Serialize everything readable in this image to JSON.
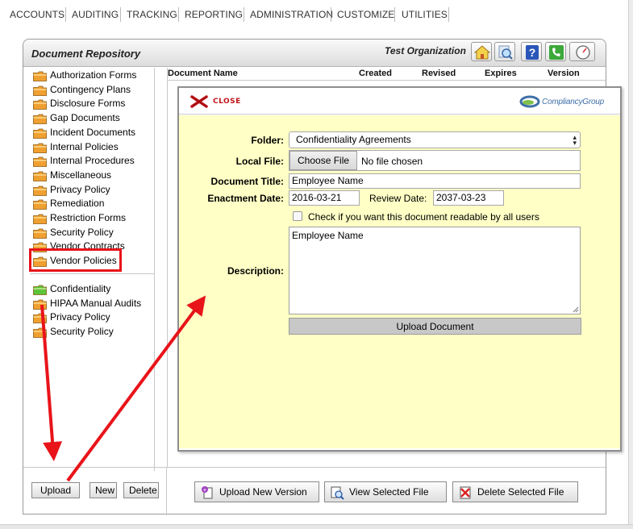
{
  "nav": {
    "items": [
      "ACCOUNTS",
      "AUDITING",
      "TRACKING",
      "REPORTING",
      "ADMINISTRATION",
      "CUSTOMIZE",
      "UTILITIES"
    ]
  },
  "panel": {
    "title": "Document Repository",
    "organization": "Test Organization",
    "header_icons": [
      "home-icon",
      "search-icon",
      "help-icon",
      "phone-icon",
      "gauge-icon"
    ]
  },
  "tree": {
    "folders_top": [
      "Authorization Forms",
      "Contingency Plans",
      "Disclosure Forms",
      "Gap Documents",
      "Incident Documents",
      "Internal Policies",
      "Internal Procedures",
      "Miscellaneous",
      "Privacy Policy",
      "Remediation",
      "Restriction Forms",
      "Security Policy",
      "Vendor Contracts",
      "Vendor Policies"
    ],
    "folders_bottom": [
      "Confidentiality",
      "HIPAA Manual Audits",
      "Privacy Policy",
      "Security Policy"
    ],
    "selected_folder": "Confidentiality"
  },
  "left_buttons": {
    "upload": "Upload",
    "new": "New",
    "delete": "Delete"
  },
  "columns": [
    "Document Name",
    "Created",
    "Revised",
    "Expires",
    "Version"
  ],
  "bottom_buttons": {
    "upload_new_version": "Upload New Version",
    "view_selected_file": "View Selected File",
    "delete_selected_file": "Delete Selected File"
  },
  "modal": {
    "close_label": "CLOSE",
    "logo_text": "CompliancyGroup",
    "folder_label": "Folder:",
    "folder_value": "Confidentiality Agreements",
    "local_file_label": "Local File:",
    "choose_file": "Choose File",
    "no_file": "No file chosen",
    "doc_title_label": "Document Title:",
    "doc_title_value": "Employee Name",
    "enactment_label": "Enactment Date:",
    "enactment_value": "2016-03-21",
    "review_label": "Review Date:",
    "review_value": "2037-03-23",
    "checkbox_label": "Check if you want this document readable by all users",
    "description_label": "Description:",
    "description_value": "Employee Name",
    "upload_button": "Upload Document"
  },
  "colors": {
    "modal_bg": "#ffffc6",
    "annotation_red": "#e8141a",
    "folder_orange": "#f0a030",
    "folder_green": "#5cc43a"
  }
}
